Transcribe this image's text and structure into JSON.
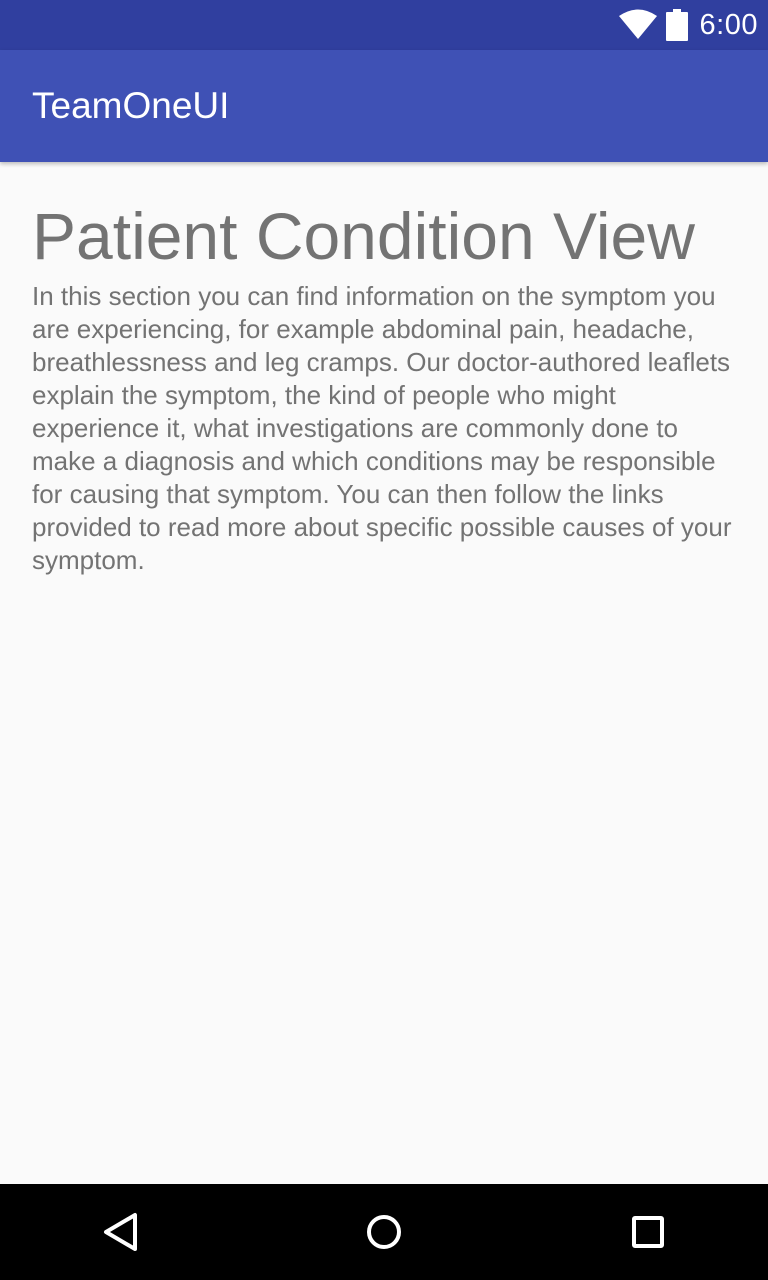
{
  "status_bar": {
    "time": "6:00",
    "icons": [
      "wifi-icon",
      "battery-icon"
    ]
  },
  "app_bar": {
    "title": "TeamOneUI"
  },
  "content": {
    "title": "Patient Condition View",
    "description": "In this section you can find information on the symptom you are experiencing, for example abdominal pain, headache, breathlessness and leg cramps. Our doctor-authored leaflets explain the symptom, the kind of people who might experience it, what investigations are commonly done to make a diagnosis and which conditions may be responsible for causing that symptom. You can then follow the links provided to read more about specific possible causes of your symptom."
  },
  "nav_bar": {
    "buttons": [
      "back-icon",
      "home-icon",
      "recents-icon"
    ]
  },
  "colors": {
    "status_bar": "#303f9f",
    "app_bar": "#3f51b5",
    "background": "#fafafa",
    "text": "#737373",
    "nav_bar": "#000000"
  }
}
